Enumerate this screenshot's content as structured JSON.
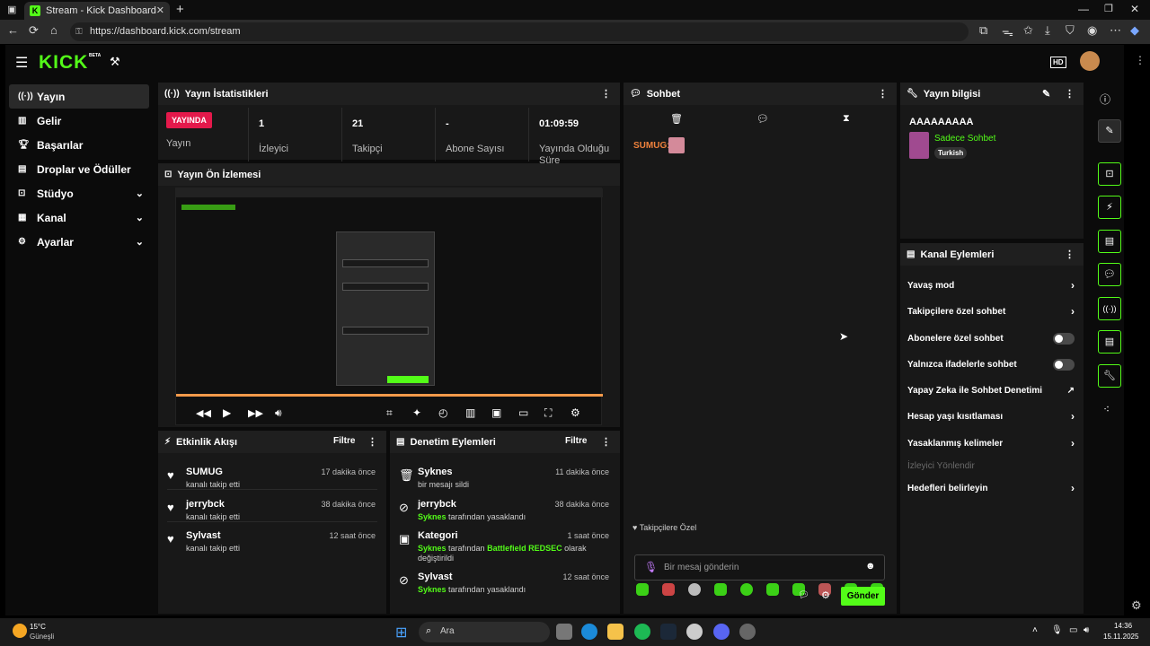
{
  "browser": {
    "tab_title": "Stream - Kick Dashboard",
    "url": "https://dashboard.kick.com/stream"
  },
  "header": {
    "logo": "KICK",
    "beta": "BETA"
  },
  "sidebar": {
    "items": [
      {
        "label": "Yayın",
        "icon": "broadcast-icon"
      },
      {
        "label": "Gelir",
        "icon": "revenue-icon"
      },
      {
        "label": "Başarılar",
        "icon": "trophy-icon"
      },
      {
        "label": "Droplar ve Ödüller",
        "icon": "gift-icon"
      },
      {
        "label": "Stüdyo",
        "icon": "studio-icon"
      },
      {
        "label": "Kanal",
        "icon": "channel-icon"
      },
      {
        "label": "Ayarlar",
        "icon": "gear-icon"
      }
    ]
  },
  "stats": {
    "title": "Yayın İstatistikleri",
    "live_badge": "YAYINDA",
    "status_label": "Yayın",
    "viewers_value": "1",
    "viewers_label": "İzleyici",
    "followers_value": "21",
    "followers_label": "Takipçi",
    "subs_value": "-",
    "subs_label": "Abone Sayısı",
    "uptime_value": "01:09:59",
    "uptime_label": "Yayında Olduğu Süre"
  },
  "preview": {
    "title": "Yayın Ön İzlemesi"
  },
  "activity": {
    "title": "Etkinlik Akışı",
    "filter": "Filtre",
    "items": [
      {
        "name": "SUMUG",
        "sub": "kanalı takip etti",
        "time": "17 dakika önce"
      },
      {
        "name": "jerrybck",
        "sub": "kanalı takip etti",
        "time": "38 dakika önce"
      },
      {
        "name": "Sylvast",
        "sub": "kanalı takip etti",
        "time": "12 saat önce"
      }
    ]
  },
  "moderation": {
    "title": "Denetim Eylemleri",
    "filter": "Filtre",
    "items": [
      {
        "name": "Syknes",
        "sub": "bir mesajı sildi",
        "time": "11 dakika önce"
      },
      {
        "name": "jerrybck",
        "sub_a": "Syknes",
        "sub_b": " tarafından yasaklandı",
        "time": "38 dakika önce"
      },
      {
        "name": "Kategori",
        "sub_a": "Syknes",
        "sub_b": " tarafından ",
        "sub_c": "Battlefield REDSEC",
        "sub_d": " olarak değiştirildi",
        "time": "1 saat önce"
      },
      {
        "name": "Sylvast",
        "sub_a": "Syknes",
        "sub_b": " tarafından yasaklandı",
        "time": "12 saat önce"
      }
    ]
  },
  "chat": {
    "title": "Sohbet",
    "message_user": "SUMUG:",
    "followers_only": "Takipçilere Özel",
    "placeholder": "Bir mesaj gönderin",
    "send": "Gönder"
  },
  "stream_info": {
    "title": "Yayın bilgisi",
    "stream_title": "AAAAAAAAA",
    "category": "Sadece Sohbet",
    "language": "Turkish"
  },
  "channel_actions": {
    "title": "Kanal Eylemleri",
    "items": [
      {
        "label": "Yavaş mod",
        "kind": "chevron"
      },
      {
        "label": "Takipçilere özel sohbet",
        "kind": "chevron"
      },
      {
        "label": "Abonelere özel sohbet",
        "kind": "toggle"
      },
      {
        "label": "Yalnızca ifadelerle sohbet",
        "kind": "toggle"
      },
      {
        "label": "Yapay Zeka ile Sohbet Denetimi",
        "kind": "external"
      },
      {
        "label": "Hesap yaşı kısıtlaması",
        "kind": "chevron"
      },
      {
        "label": "Yasaklanmış kelimeler",
        "kind": "chevron"
      },
      {
        "label": "İzleyici Yönlendir",
        "kind": "disabled"
      },
      {
        "label": "Hedefleri belirleyin",
        "kind": "chevron"
      }
    ]
  },
  "taskbar": {
    "weather_temp": "15°C",
    "weather_desc": "Güneşli",
    "search": "Ara",
    "time": "14:36",
    "date": "15.11.2025"
  },
  "colors": {
    "accent": "#53fc18",
    "live": "#e4194b"
  }
}
